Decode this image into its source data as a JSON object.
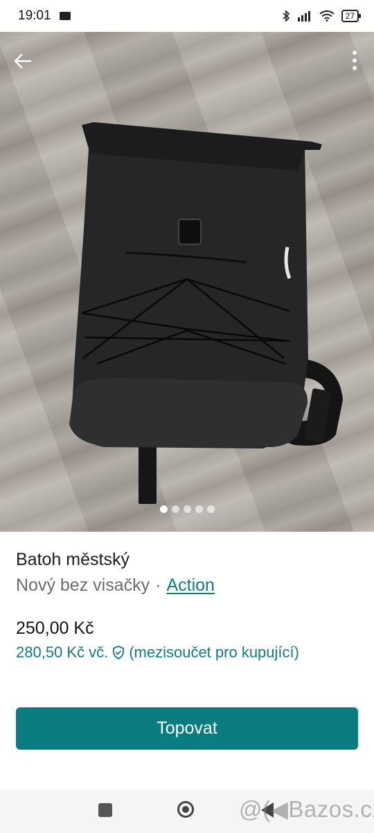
{
  "status": {
    "time": "19:01",
    "battery": "27",
    "icons": [
      "mail-icon",
      "bluetooth-icon",
      "signal-icon",
      "wifi-icon",
      "battery-icon"
    ]
  },
  "header": {
    "back_icon": "back-arrow-icon",
    "menu_icon": "more-vert-icon"
  },
  "carousel": {
    "total": 5,
    "active_index": 0
  },
  "listing": {
    "title": "Batoh městský",
    "condition": "Nový bez visačky",
    "separator": "·",
    "brand": "Action",
    "price": "250,00 Kč",
    "buyer_price": "280,50 Kč",
    "buyer_incl": "vč.",
    "buyer_note": "(mezisoučet pro kupující)"
  },
  "actions": {
    "promote_label": "Topovat"
  },
  "watermark": {
    "text": "@(◀Bazos.cz"
  },
  "colors": {
    "accent": "#0a7d80",
    "link": "#127a7e"
  }
}
